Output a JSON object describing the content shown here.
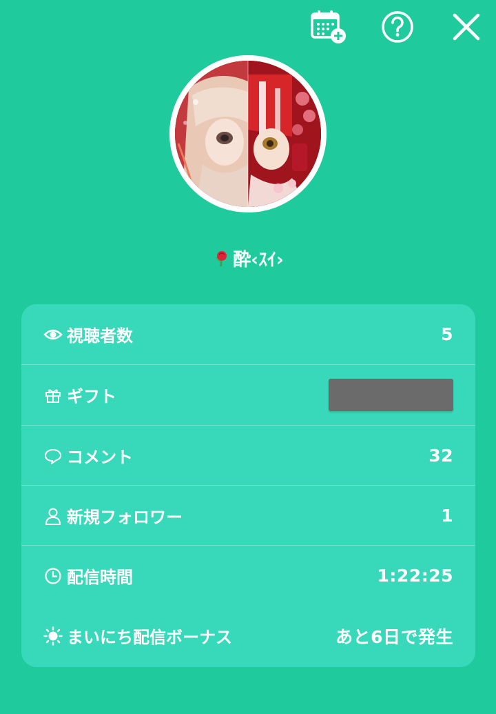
{
  "header": {
    "icons": [
      "calendar-plus-icon",
      "help-icon",
      "close-icon"
    ]
  },
  "profile": {
    "name": "酔‹ｽｲ›"
  },
  "stats": {
    "viewers": {
      "label": "視聴者数",
      "value": "5"
    },
    "gifts": {
      "label": "ギフト",
      "value": ""
    },
    "comments": {
      "label": "コメント",
      "value": "32"
    },
    "new_followers": {
      "label": "新規フォロワー",
      "value": "1"
    },
    "stream_time": {
      "label": "配信時間",
      "value": "1:22:25"
    },
    "daily_bonus": {
      "label": "まいにち配信ボーナス",
      "value": "あと6日で発生"
    }
  },
  "colors": {
    "background": "#1fca9c",
    "card": "#38d8ba",
    "text": "#ffffff",
    "redacted": "#6b6b6b"
  }
}
